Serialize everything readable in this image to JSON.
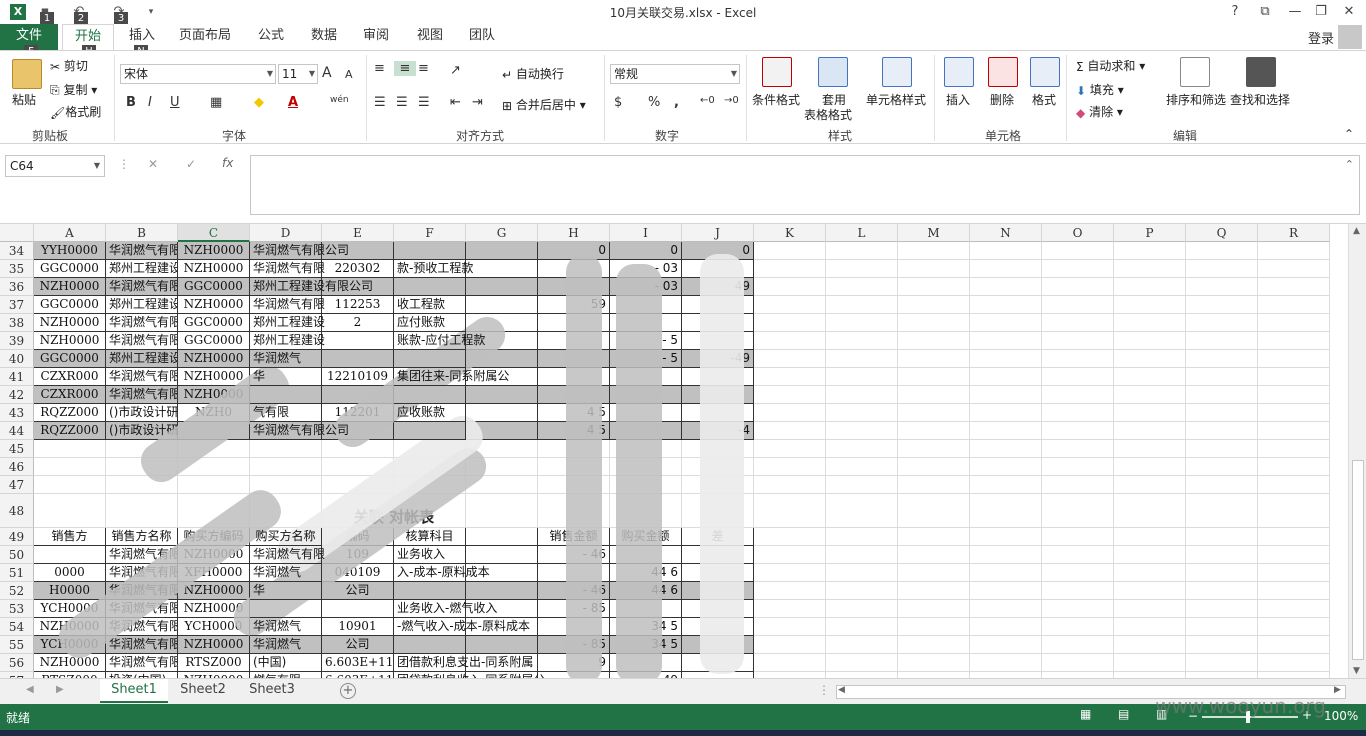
{
  "window": {
    "title": "10月关联交易.xlsx - Excel",
    "help": "?",
    "qat_keytips": [
      "1",
      "2",
      "3"
    ]
  },
  "ribbon_tabs": {
    "file": "文件",
    "tabs": [
      "开始",
      "插入",
      "页面布局",
      "公式",
      "数据",
      "审阅",
      "视图",
      "团队"
    ],
    "keytips": {
      "file": "F",
      "home": "H",
      "insert": "N"
    },
    "login": "登录"
  },
  "ribbon": {
    "clipboard": {
      "label": "剪贴板",
      "paste": "粘贴",
      "cut": "剪切",
      "copy": "复制",
      "format_painter": "格式刷"
    },
    "font": {
      "label": "字体",
      "name": "宋体",
      "size": "11",
      "bold": "B",
      "italic": "I",
      "underline": "U",
      "grow": "A",
      "shrink": "A",
      "wen": "wén"
    },
    "alignment": {
      "label": "对齐方式",
      "wrap": "自动换行",
      "merge": "合并后居中"
    },
    "number": {
      "label": "数字",
      "format": "常规",
      "percent": "%",
      "comma": ","
    },
    "styles": {
      "label": "样式",
      "conditional": "条件格式",
      "table1": "套用",
      "table2": "表格格式",
      "cell_styles": "单元格样式"
    },
    "cells": {
      "label": "单元格",
      "insert": "插入",
      "delete": "删除",
      "format": "格式"
    },
    "editing": {
      "label": "编辑",
      "autosum": "自动求和",
      "fill": "填充",
      "clear": "清除",
      "sort": "排序和筛选",
      "find": "查找和选择"
    }
  },
  "formula_bar": {
    "name_box": "C64",
    "fx": "fx",
    "cancel": "✕",
    "confirm": "✓",
    "value": ""
  },
  "columns": [
    "A",
    "B",
    "C",
    "D",
    "E",
    "F",
    "G",
    "H",
    "I",
    "J",
    "K",
    "L",
    "M",
    "N",
    "O",
    "P",
    "Q",
    "R"
  ],
  "selected_column": "C",
  "rows": [
    {
      "n": "34",
      "gray": true,
      "cells": [
        "YYH0000",
        "华润燃气有限",
        "NZH0000",
        "华润燃气有限公司",
        "",
        "",
        "",
        "0",
        "0",
        "0"
      ]
    },
    {
      "n": "35",
      "gray": false,
      "cells": [
        "GGC0000",
        "郑州工程建设",
        "NZH0000",
        "华润燃气有限",
        "220302",
        "款-预收工程款",
        "",
        "",
        "-    03",
        ""
      ]
    },
    {
      "n": "36",
      "gray": true,
      "cells": [
        "NZH0000",
        "华润燃气有限",
        "GGC0000",
        "郑州工程建设有限公司",
        "",
        "",
        "",
        "",
        "-    03",
        "49"
      ]
    },
    {
      "n": "37",
      "gray": false,
      "cells": [
        "GGC0000",
        "郑州工程建设",
        "NZH0000",
        "华润燃气有限",
        "112253",
        "收工程款",
        "",
        "59",
        "",
        ""
      ]
    },
    {
      "n": "38",
      "gray": false,
      "cells": [
        "NZH0000",
        "华润燃气有限",
        "GGC0000",
        "郑州工程建设",
        "2",
        "应付账款",
        "",
        "",
        "",
        ""
      ]
    },
    {
      "n": "39",
      "gray": false,
      "cells": [
        "NZH0000",
        "华润燃气有限",
        "GGC0000",
        "郑州工程建设",
        "",
        "账款-应付工程款",
        "",
        "",
        "-   5",
        ""
      ]
    },
    {
      "n": "40",
      "gray": true,
      "cells": [
        "GGC0000",
        "郑州工程建设",
        "NZH0000",
        "华润燃气",
        "",
        "",
        "",
        "",
        "-   5",
        "-49"
      ]
    },
    {
      "n": "41",
      "gray": false,
      "cells": [
        "CZXR000",
        "华润燃气有限",
        "NZH0000",
        "华",
        "12210109",
        "集团往来-同系附属公",
        "",
        "",
        "",
        ""
      ]
    },
    {
      "n": "42",
      "gray": true,
      "cells": [
        "CZXR000",
        "华润燃气有限",
        "NZH0000",
        "",
        "",
        "",
        "",
        "",
        "",
        ""
      ]
    },
    {
      "n": "43",
      "gray": false,
      "cells": [
        "RQZZ000",
        "()市政设计研",
        "NZH0",
        "气有限",
        "112201",
        "应收账款",
        "",
        "4   5",
        "",
        ""
      ]
    },
    {
      "n": "44",
      "gray": true,
      "cells": [
        "RQZZ000",
        "()市政设计研",
        "",
        "华润燃气有限公司",
        "",
        "",
        "",
        "4   5",
        "",
        "-4"
      ]
    },
    {
      "n": "45",
      "gray": false,
      "empty": true
    },
    {
      "n": "46",
      "gray": false,
      "empty": true
    },
    {
      "n": "47",
      "gray": false,
      "empty": true
    },
    {
      "n": "48",
      "title": "关联    对帐表"
    },
    {
      "n": "49",
      "header": true,
      "cells": [
        "销售方",
        "销售方名称",
        "购买方编码",
        "购买方名称",
        "编码",
        "核算科目",
        "",
        "销售金额",
        "购买金额",
        "差"
      ]
    },
    {
      "n": "50",
      "gray": false,
      "cells": [
        "",
        "华润燃气有限",
        "NZH0000",
        "华润燃气有限",
        "109",
        "业务收入",
        "",
        "-   46",
        "",
        ""
      ]
    },
    {
      "n": "51",
      "gray": false,
      "cells": [
        "  0000",
        "华润燃气有限",
        "XFH0000",
        "华润燃气",
        "040109",
        "入-成本-原料成本",
        "",
        "",
        "44   6",
        ""
      ]
    },
    {
      "n": "52",
      "gray": true,
      "cells": [
        "  H0000",
        "华润燃气有限",
        "NZH0000",
        "华",
        "公司",
        "",
        "",
        "-   46",
        "44   6",
        ""
      ]
    },
    {
      "n": "53",
      "gray": false,
      "cells": [
        "YCH0000",
        "华润燃气有限",
        "NZH0000",
        "",
        "",
        "业务收入-燃气收入",
        "",
        "-   85",
        "",
        ""
      ]
    },
    {
      "n": "54",
      "gray": false,
      "cells": [
        "NZH0000",
        "华润燃气有限",
        "YCH0000",
        "华润燃气",
        "10901",
        "-燃气收入-成本-原料成本",
        "",
        "",
        "34   5",
        ""
      ]
    },
    {
      "n": "55",
      "gray": true,
      "cells": [
        "YCH0000",
        "华润燃气有限",
        "NZH0000",
        "华润燃气",
        "公司",
        "",
        "",
        "-   85",
        "34   5",
        ""
      ]
    },
    {
      "n": "56",
      "gray": false,
      "cells": [
        "NZH0000",
        "华润燃气有限",
        "RTSZ000",
        "(中国)",
        "6.603E+11",
        "团借款利息支出-同系附属",
        "",
        "9",
        "",
        ""
      ]
    },
    {
      "n": "57",
      "gray": false,
      "cells": [
        "RTSZ000",
        "投资(中国)",
        "NZH0000",
        "燃气有限",
        "6.603E+11",
        "团贷款利息收入-同系附属公",
        "",
        "",
        "49",
        ""
      ]
    }
  ],
  "sheets": [
    "Sheet1",
    "Sheet2",
    "Sheet3"
  ],
  "active_sheet": "Sheet1",
  "status": {
    "ready": "就绪",
    "zoom": "100%"
  },
  "watermark": "www.wooyun.org"
}
